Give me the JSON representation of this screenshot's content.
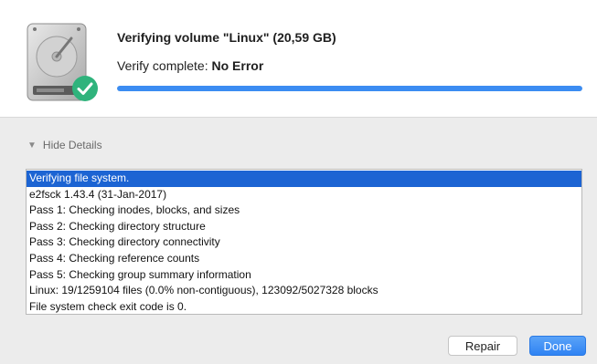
{
  "header": {
    "title": "Verifying volume \"Linux\" (20,59 GB)",
    "status_prefix": "Verify complete: ",
    "status_value": "No Error",
    "progress_percent": 100
  },
  "details_toggle": {
    "label": "Hide Details"
  },
  "log": {
    "selected_index": 0,
    "lines": [
      "Verifying file system.",
      "e2fsck 1.43.4 (31-Jan-2017)",
      "Pass 1: Checking inodes, blocks, and sizes",
      "Pass 2: Checking directory structure",
      "Pass 3: Checking directory connectivity",
      "Pass 4: Checking reference counts",
      "Pass 5: Checking group summary information",
      "Linux: 19/1259104 files (0.0% non-contiguous), 123092/5027328 blocks",
      "File system check exit code is 0."
    ]
  },
  "buttons": {
    "repair": "Repair",
    "done": "Done"
  },
  "icons": {
    "disk": "hard-drive-icon",
    "check": "checkmark-badge-icon",
    "triangle": "disclosure-triangle-down-icon"
  },
  "colors": {
    "accent": "#3b8cf2",
    "selection": "#1c64d3",
    "badge": "#2fb37c"
  }
}
